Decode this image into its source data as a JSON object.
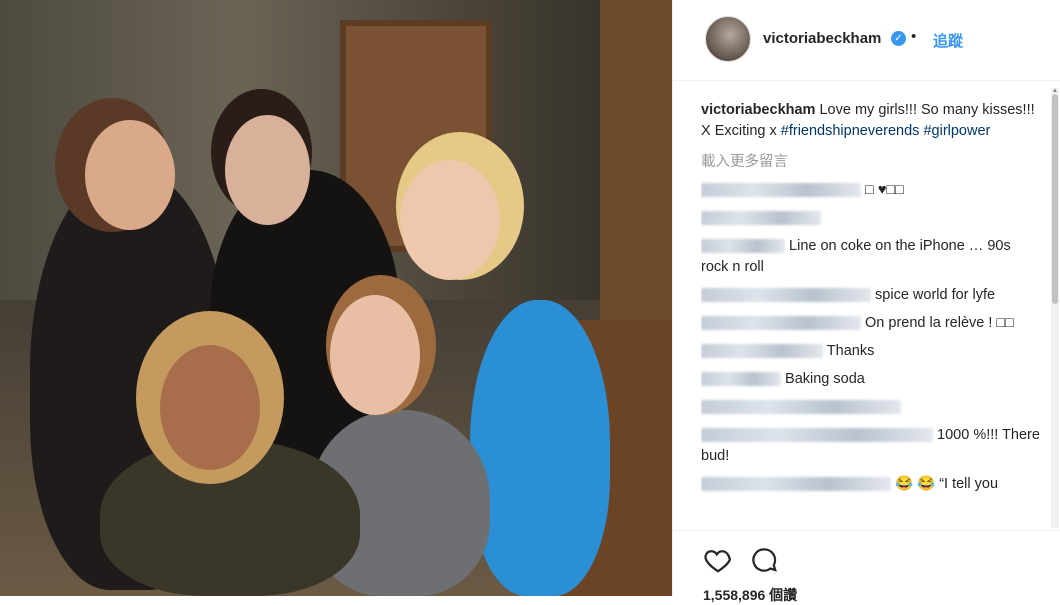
{
  "post": {
    "username": "victoriabeckham",
    "verified_icon": "verified-badge-icon",
    "dot": "•",
    "follow_label": "追蹤"
  },
  "caption": {
    "username": "victoriabeckham",
    "text": "Love my girls!!! So many kisses!!! X Exciting x",
    "hashtag1": "#friendshipneverends",
    "hashtag2": "#girlpower"
  },
  "load_more": "載入更多留言",
  "comments": [
    {
      "text": "□ ♥□□"
    },
    {
      "text": ""
    },
    {
      "text": "Line on coke on the iPhone … 90s rock n roll"
    },
    {
      "text": "spice world for lyfe"
    },
    {
      "text": "On prend la relève ! □□"
    },
    {
      "text": "Thanks"
    },
    {
      "text": "Baking soda"
    },
    {
      "text": ""
    },
    {
      "text": "1000 %!!! There bud!"
    },
    {
      "text": "😂 😂 “I tell you"
    }
  ],
  "actions": {
    "like_icon": "heart-icon",
    "comment_icon": "comment-icon",
    "likes_text": "1,558,896 個讚"
  },
  "colors": {
    "link": "#003569",
    "accent": "#3897f0",
    "text": "#262626",
    "muted": "#999999"
  }
}
